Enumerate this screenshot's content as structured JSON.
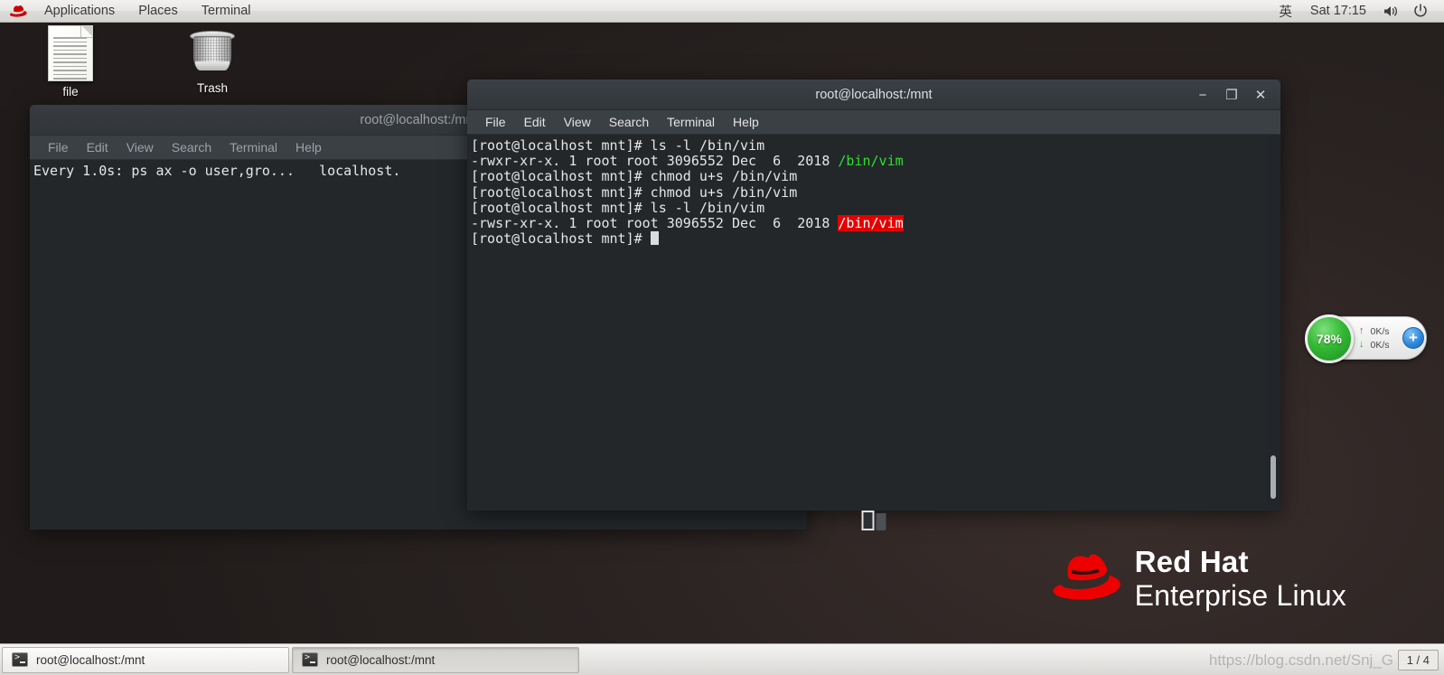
{
  "top_panel": {
    "logo_icon": "redhat-logo-icon",
    "menus": [
      "Applications",
      "Places",
      "Terminal"
    ],
    "input_method": "英",
    "clock": "Sat 17:15",
    "volume_icon": "volume-icon",
    "power_icon": "power-icon"
  },
  "desktop": {
    "icons": [
      {
        "label": "file",
        "icon": "document-icon"
      },
      {
        "label": "Trash",
        "icon": "trash-icon"
      }
    ],
    "brand": {
      "line1": "Red Hat",
      "line2": "Enterprise Linux",
      "logo_icon": "redhat-fedora-icon"
    }
  },
  "background_window": {
    "title": "root@localhost:/mnt",
    "menus": [
      "File",
      "Edit",
      "View",
      "Search",
      "Terminal",
      "Help"
    ],
    "lines": [
      "Every 1.0s: ps ax -o user,gro...   localhost."
    ]
  },
  "active_window": {
    "title": "root@localhost:/mnt",
    "menus": [
      "File",
      "Edit",
      "View",
      "Search",
      "Terminal",
      "Help"
    ],
    "window_buttons": {
      "minimize": "−",
      "maximize": "❐",
      "close": "✕"
    },
    "lines": [
      {
        "parts": [
          {
            "text": "[root@localhost mnt]# ls -l /bin/vim",
            "style": "plain"
          }
        ]
      },
      {
        "parts": [
          {
            "text": "-rwxr-xr-x. 1 root root 3096552 Dec  6  2018 ",
            "style": "plain"
          },
          {
            "text": "/bin/vim",
            "style": "green"
          }
        ]
      },
      {
        "parts": [
          {
            "text": "[root@localhost mnt]# chmod u+s /bin/vim",
            "style": "plain"
          }
        ]
      },
      {
        "parts": [
          {
            "text": "[root@localhost mnt]# chmod u+s /bin/vim",
            "style": "plain"
          }
        ]
      },
      {
        "parts": [
          {
            "text": "[root@localhost mnt]# ls -l /bin/vim",
            "style": "plain"
          }
        ]
      },
      {
        "parts": [
          {
            "text": "-rwsr-xr-x. 1 root root 3096552 Dec  6  2018 ",
            "style": "plain"
          },
          {
            "text": "/bin/vim",
            "style": "setuid"
          }
        ]
      },
      {
        "parts": [
          {
            "text": "[root@localhost mnt]# ",
            "style": "plain"
          },
          {
            "text": "",
            "style": "cursor"
          }
        ]
      }
    ]
  },
  "net_widget": {
    "cpu_percent": "78%",
    "upload_rate": "0K/s",
    "download_rate": "0K/s",
    "up_arrow": "↑",
    "down_arrow": "↓",
    "add_label": "+"
  },
  "taskbar": {
    "buttons": [
      {
        "label": "root@localhost:/mnt",
        "icon": "terminal-icon",
        "state": "normal"
      },
      {
        "label": "root@localhost:/mnt",
        "icon": "terminal-icon",
        "state": "pressed"
      }
    ],
    "workspace": "1 / 4"
  },
  "watermark": "https://blog.csdn.net/Snj_G",
  "colors": {
    "setuid_bg": "#e50000",
    "executable_green": "#2ee02e",
    "terminal_bg": "#23272a",
    "redhat_red": "#ee0000",
    "gauge_green": "#34b934"
  }
}
